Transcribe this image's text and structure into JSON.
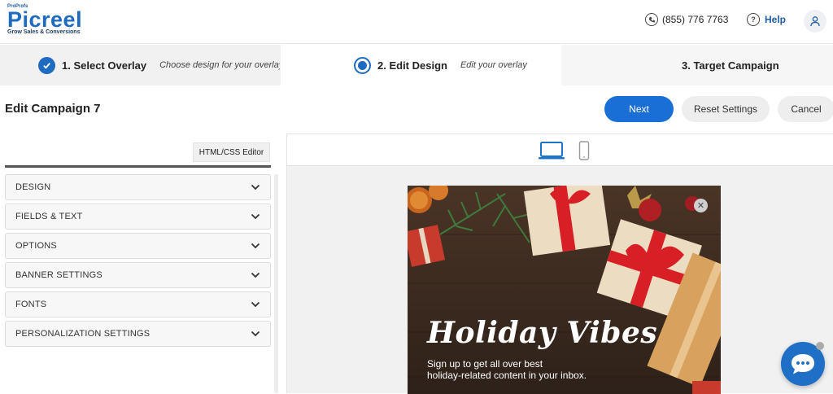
{
  "header": {
    "logo_top": "ProProfs",
    "logo_main": "Picreel",
    "logo_tagline": "Grow Sales & Conversions",
    "phone": "(855) 776 7763",
    "help": "Help"
  },
  "steps": [
    {
      "title": "1. Select Overlay",
      "subtitle": "Choose design for your overlay",
      "state": "completed"
    },
    {
      "title": "2. Edit Design",
      "subtitle": "Edit your overlay",
      "state": "active"
    },
    {
      "title": "3. Target Campaign",
      "subtitle": "",
      "state": "pending"
    }
  ],
  "page": {
    "title": "Edit Campaign 7"
  },
  "actions": {
    "next": "Next",
    "reset": "Reset Settings",
    "cancel": "Cancel"
  },
  "editor": {
    "html_css_button": "HTML/CSS Editor"
  },
  "accordion": [
    {
      "label": "DESIGN"
    },
    {
      "label": "FIELDS & TEXT"
    },
    {
      "label": "OPTIONS"
    },
    {
      "label": "BANNER SETTINGS"
    },
    {
      "label": "FONTS"
    },
    {
      "label": "PERSONALIZATION SETTINGS"
    }
  ],
  "preview": {
    "devices": [
      "laptop-icon",
      "mobile-icon"
    ],
    "active_device": "laptop",
    "popup_title": "Holiday Vibes",
    "popup_text_line1": "Sign up to get all over best",
    "popup_text_line2": "holiday-related content in your inbox."
  },
  "colors": {
    "brand": "#1e6bc1",
    "primary_button": "#1a6fd6",
    "chat": "#1f6fc7"
  }
}
